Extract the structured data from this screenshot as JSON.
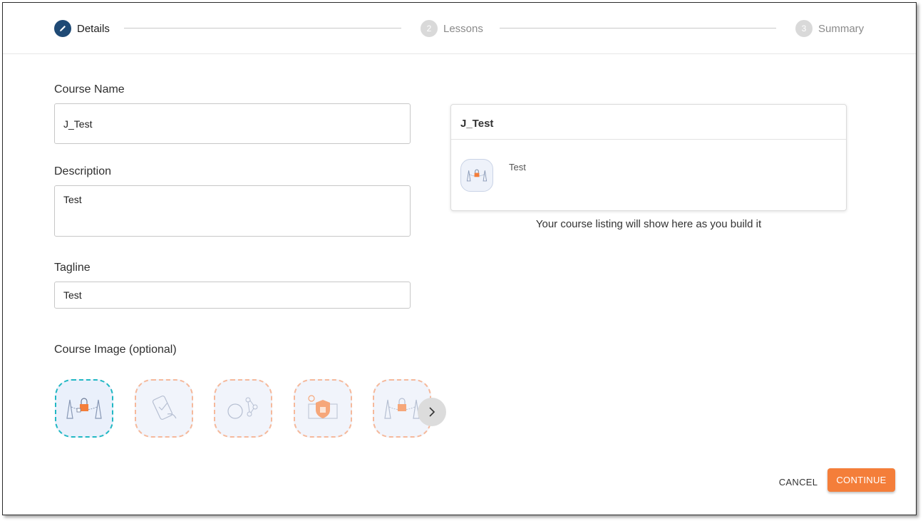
{
  "stepper": {
    "steps": [
      {
        "number": "",
        "label": "Details",
        "state": "active"
      },
      {
        "number": "2",
        "label": "Lessons",
        "state": "inactive"
      },
      {
        "number": "3",
        "label": "Summary",
        "state": "inactive"
      }
    ]
  },
  "form": {
    "course_name": {
      "label": "Course Name",
      "value": "J_Test"
    },
    "description": {
      "label": "Description",
      "value": "Test"
    },
    "tagline": {
      "label": "Tagline",
      "value": "Test"
    },
    "course_image": {
      "label": "Course Image (optional)",
      "images": [
        "laptop-lock-illustration",
        "phone-checklist-illustration",
        "network-user-illustration",
        "shield-desk-illustration",
        "laptop-lock-illustration"
      ],
      "selected_index": 0
    }
  },
  "preview": {
    "title": "J_Test",
    "tagline": "Test",
    "caption": "Your course listing will show here as you build it"
  },
  "actions": {
    "cancel_label": "CANCEL",
    "continue_label": "CONTINUE"
  },
  "colors": {
    "accent": "#f47e3a",
    "active_step": "#1f4a75",
    "selected_border": "#22b8c4"
  }
}
